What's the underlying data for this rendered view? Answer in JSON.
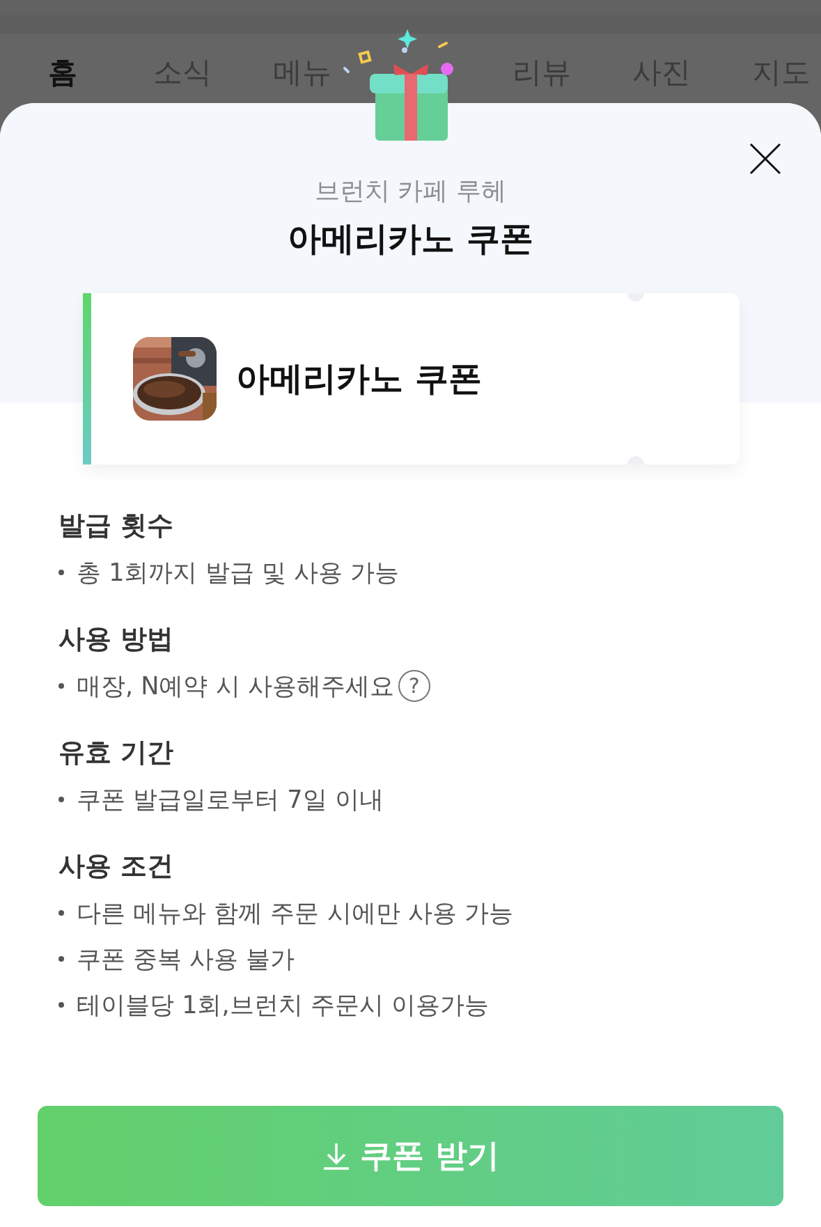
{
  "tabs": [
    {
      "label": "홈",
      "selected": true
    },
    {
      "label": "소식",
      "selected": false
    },
    {
      "label": "메뉴",
      "selected": false
    },
    {
      "label": "리뷰",
      "selected": false
    },
    {
      "label": "사진",
      "selected": false
    },
    {
      "label": "지도",
      "selected": false
    }
  ],
  "sheet": {
    "store_name": "브런치 카페 루헤",
    "title": "아메리카노 쿠폰",
    "coupon": {
      "name": "아메리카노 쿠폰"
    },
    "sections": [
      {
        "heading": "발급 횟수",
        "items": [
          {
            "text": "총 1회까지 발급 및 사용 가능"
          }
        ]
      },
      {
        "heading": "사용 방법",
        "items": [
          {
            "text": "매장, N예약 시 사용해주세요",
            "help": "?"
          }
        ]
      },
      {
        "heading": "유효 기간",
        "items": [
          {
            "text": "쿠폰 발급일로부터 7일 이내"
          }
        ]
      },
      {
        "heading": "사용 조건",
        "items": [
          {
            "text": "다른 메뉴와 함께 주문 시에만 사용 가능"
          },
          {
            "text": "쿠폰 중복 사용 불가"
          },
          {
            "text": "테이블당 1회,브런치 주문시 이용가능"
          }
        ]
      }
    ],
    "button": "쿠폰 받기"
  }
}
